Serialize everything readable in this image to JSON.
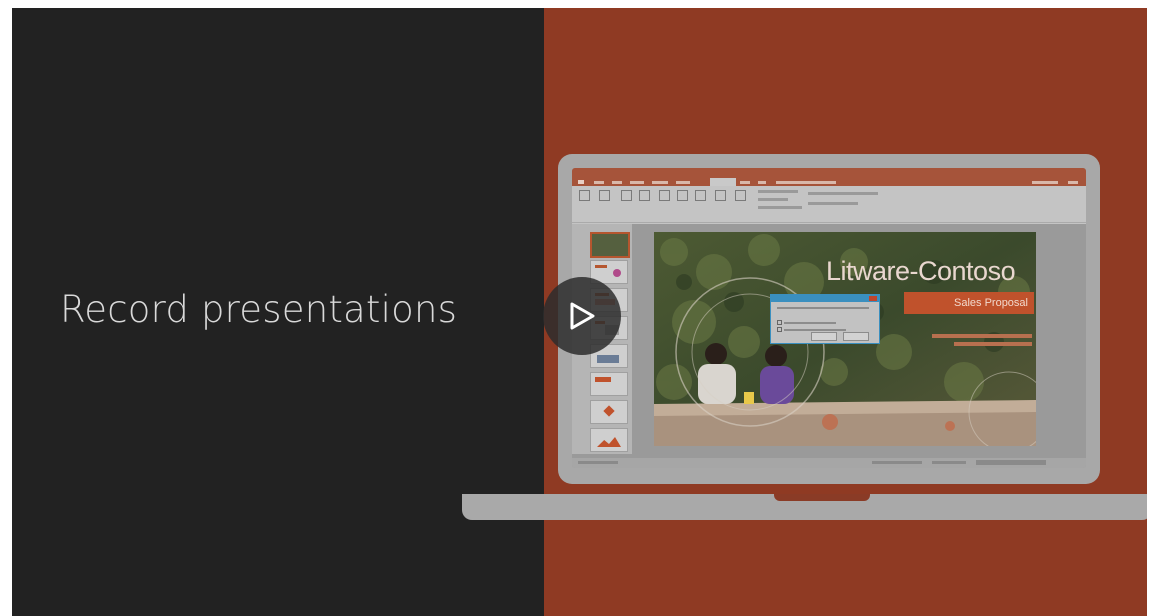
{
  "headline": "Record presentations",
  "video": {
    "play_icon": "play-icon"
  },
  "colors": {
    "left_bg": "#222222",
    "right_bg": "#8f3a23",
    "laptop": "#a8a8a8",
    "accent": "#c0522c"
  },
  "slide": {
    "title": "Litware-Contoso",
    "subtitle": "Sales Proposal"
  }
}
